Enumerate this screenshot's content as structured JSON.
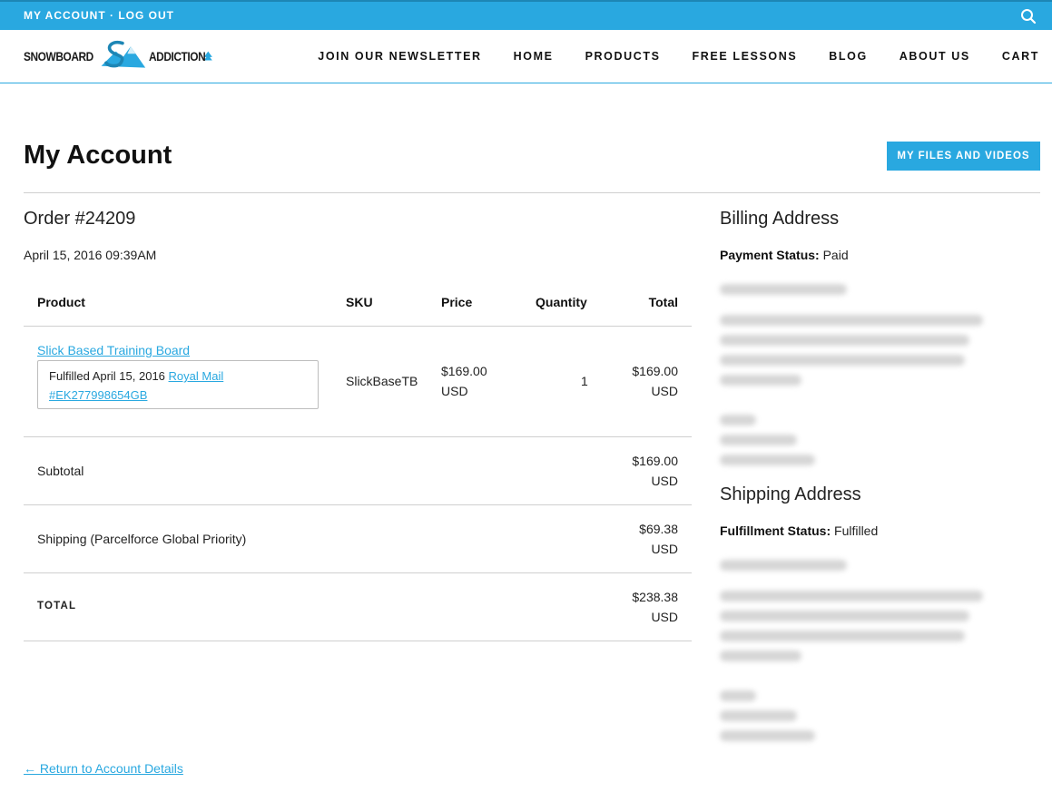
{
  "topbar": {
    "account_links": "MY ACCOUNT · LOG OUT",
    "search_icon": "search-icon",
    "background": "#29a8e0"
  },
  "header": {
    "logo_word_left": "SNOWBOARD",
    "logo_word_right": "ADDICTION",
    "nav": [
      "JOIN OUR NEWSLETTER",
      "HOME",
      "PRODUCTS",
      "FREE LESSONS",
      "BLOG",
      "ABOUT US",
      "CART"
    ]
  },
  "page": {
    "title": "My Account",
    "files_button": "MY FILES AND VIDEOS"
  },
  "order": {
    "title": "Order #24209",
    "date": "April 15, 2016 09:39AM",
    "columns": [
      "Product",
      "SKU",
      "Price",
      "Quantity",
      "Total"
    ],
    "item": {
      "name": "Slick Based Training Board",
      "fulfilled_text": "Fulfilled April 15, 2016",
      "carrier": "Royal Mail",
      "tracking": "#EK277998654GB",
      "sku": "SlickBaseTB",
      "price": "$169.00",
      "price_currency": "USD",
      "quantity": "1",
      "total": "$169.00",
      "total_currency": "USD"
    },
    "subtotal_label": "Subtotal",
    "subtotal_value": "$169.00",
    "subtotal_currency": "USD",
    "shipping_label": "Shipping (Parcelforce Global Priority)",
    "shipping_value": "$69.38",
    "shipping_currency": "USD",
    "total_label": "TOTAL",
    "total_value": "$238.38",
    "total_currency": "USD"
  },
  "billing": {
    "heading": "Billing Address",
    "status_label": "Payment Status:",
    "status_value": "Paid"
  },
  "shipping": {
    "heading": "Shipping Address",
    "status_label": "Fulfillment Status:",
    "status_value": "Fulfilled"
  },
  "footer": {
    "return_link": "← Return to Account Details"
  },
  "colors": {
    "accent": "#29a8e0",
    "text": "#222222",
    "rule": "#cfcfcf"
  }
}
